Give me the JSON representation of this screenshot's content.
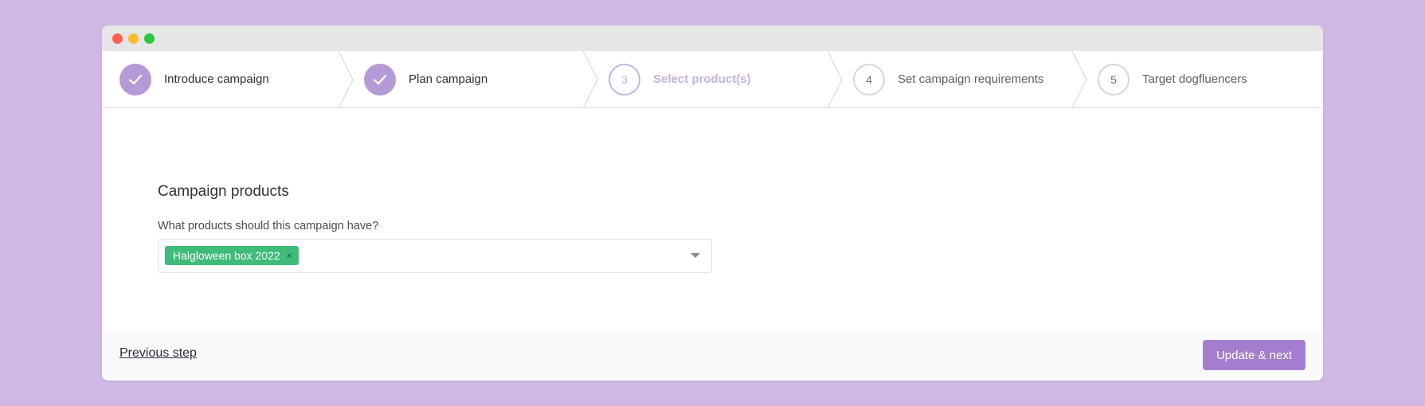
{
  "window": {
    "controls": [
      "close",
      "minimize",
      "maximize"
    ]
  },
  "steps": [
    {
      "number": "1",
      "label": "Introduce campaign",
      "status": "done",
      "icon": "check-icon"
    },
    {
      "number": "2",
      "label": "Plan campaign",
      "status": "done",
      "icon": "check-icon"
    },
    {
      "number": "3",
      "label": "Select product(s)",
      "status": "current"
    },
    {
      "number": "4",
      "label": "Set campaign requirements",
      "status": "todo"
    },
    {
      "number": "5",
      "label": "Target dogfluencers",
      "status": "todo"
    }
  ],
  "form": {
    "section_title": "Campaign products",
    "field_label": "What products should this campaign have?",
    "selected_tags": [
      {
        "label": "Halgloween box 2022",
        "remove_glyph": "×"
      }
    ],
    "dropdown_icon": "chevron-down-icon"
  },
  "footer": {
    "previous_label": "Previous step",
    "next_label": "Update & next"
  },
  "colors": {
    "background": "#cfb9e4",
    "accent": "#a47ece",
    "step_done": "#b59ad8",
    "step_current": "#c6b2e1",
    "tag": "#3fbc79"
  }
}
